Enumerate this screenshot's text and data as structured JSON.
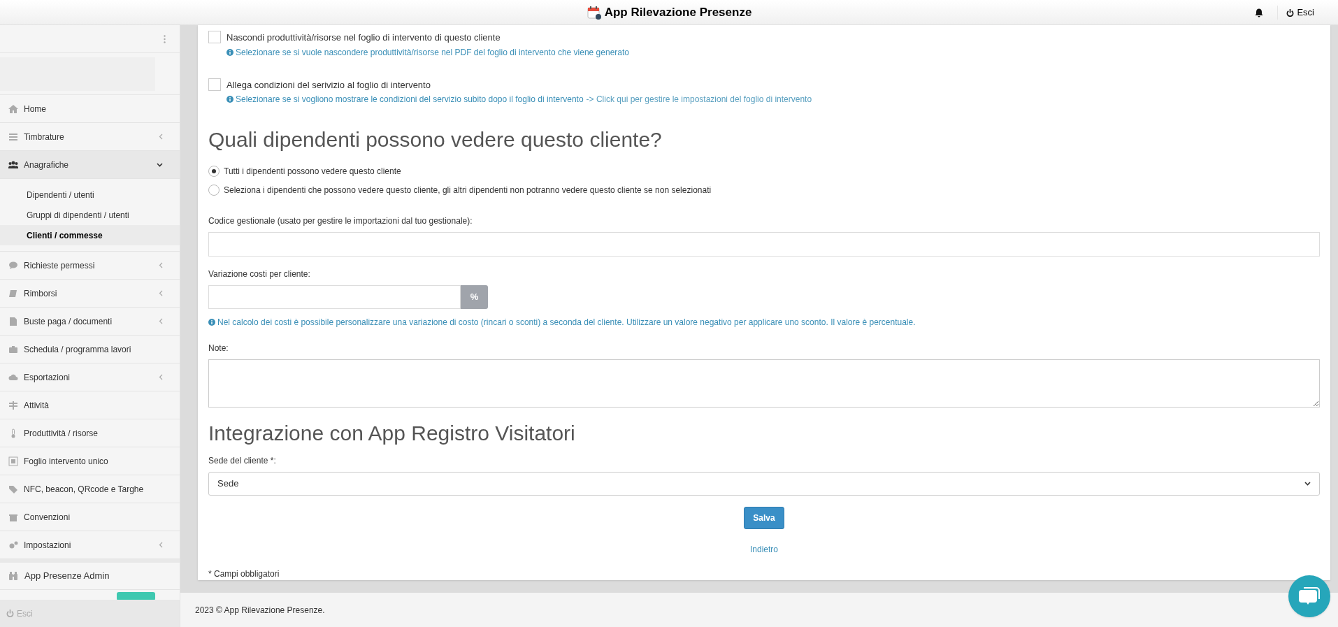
{
  "header": {
    "title": "App Rilevazione Presenze",
    "logout": "Esci"
  },
  "sidebar": {
    "items": [
      {
        "label": "Home"
      },
      {
        "label": "Timbrature",
        "expanded": false
      },
      {
        "label": "Anagrafiche",
        "expanded": true,
        "children": [
          {
            "label": "Dipendenti / utenti",
            "selected": false
          },
          {
            "label": "Gruppi di dipendenti / utenti",
            "selected": false
          },
          {
            "label": "Clienti / commesse",
            "selected": true
          }
        ]
      },
      {
        "label": "Richieste permessi",
        "expanded": false
      },
      {
        "label": "Rimborsi",
        "expanded": false
      },
      {
        "label": "Buste paga / documenti",
        "expanded": false
      },
      {
        "label": "Schedula / programma lavori"
      },
      {
        "label": "Esportazioni",
        "expanded": false
      },
      {
        "label": "Attività"
      },
      {
        "label": "Produttività / risorse"
      },
      {
        "label": "Foglio intervento unico"
      },
      {
        "label": "NFC, beacon, QRcode e Targhe"
      },
      {
        "label": "Convenzioni"
      },
      {
        "label": "Impostazioni",
        "expanded": false
      }
    ],
    "admin_item": "App Presenze Admin",
    "logout": "Esci"
  },
  "form": {
    "checkboxes": [
      {
        "label": "Nascondi produttività/risorse nel foglio di intervento di questo cliente",
        "checked": false,
        "help": "Selezionare se si vuole nascondere produttività/risorse nel PDF del foglio di intervento che viene generato"
      },
      {
        "label": "Allega condizioni del serivizio al foglio di intervento",
        "checked": false,
        "help": "Selezionare se si vogliono mostrare le condizioni del servizio subito dopo il foglio di intervento",
        "link": "-> Click qui per gestire le impostazioni del foglio di intervento"
      }
    ],
    "visibility": {
      "title": "Quali dipendenti possono vedere questo cliente?",
      "options": [
        {
          "label": "Tutti i dipendenti possono vedere questo cliente",
          "selected": true
        },
        {
          "label": "Seleziona i dipendenti che possono vedere questo cliente, gli altri dipendenti non potranno vedere questo cliente se non selezionati",
          "selected": false
        }
      ]
    },
    "management_code": {
      "label": "Codice gestionale (usato per gestire le importazioni dal tuo gestionale):"
    },
    "cost_variation": {
      "label": "Variazione costi per cliente:",
      "addon": "%",
      "help": "Nel calcolo dei costi è possibile personalizzare una variazione di costo (rincari o sconti) a seconda del cliente. Utilizzare un valore negativo per applicare uno sconto. Il valore è percentuale."
    },
    "notes": {
      "label": "Note:"
    },
    "integration": {
      "title": "Integrazione con App Registro Visitatori",
      "site_label": "Sede del cliente *:",
      "site_value": "Sede"
    },
    "save": "Salva",
    "back": "Indietro",
    "required_note": "* Campi obbligatori"
  },
  "footer": "2023 © App Rilevazione Presenze."
}
